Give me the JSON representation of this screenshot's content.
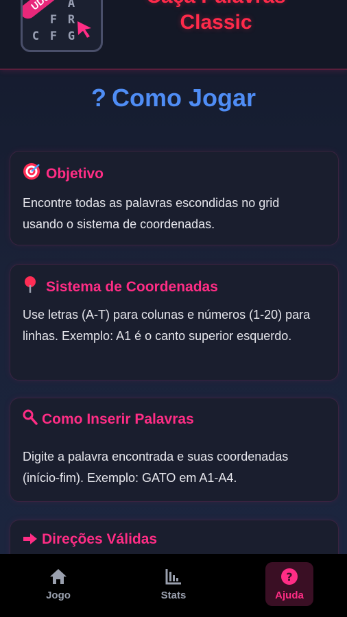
{
  "header": {
    "title_line1": "Caça Palavras",
    "title_line2": "Classic",
    "logo": {
      "pill_text": "UDU",
      "rows": [
        [
          "C",
          "A"
        ],
        [
          "F",
          "R"
        ],
        [
          "C",
          "F",
          "G"
        ]
      ]
    }
  },
  "page": {
    "title_icon": "?",
    "title": "Como Jogar"
  },
  "cards": [
    {
      "icon": "target-icon",
      "title": "Objetivo",
      "text": "Encontre todas as palavras escondidas no grid usando o sistema de coordenadas."
    },
    {
      "icon": "pin-icon",
      "title": "Sistema de Coordenadas",
      "text": "Use letras (A-T) para colunas e números (1-20) para linhas. Exemplo: A1 é o canto superior esquerdo."
    },
    {
      "icon": "magnifier-icon",
      "title": "Como Inserir Palavras",
      "text": "Digite a palavra encontrada e suas coordenadas (início-fim). Exemplo: GATO em A1-A4."
    },
    {
      "icon": "arrow-right-icon",
      "title": "Direções Válidas",
      "text": ""
    }
  ],
  "nav": {
    "items": [
      {
        "label": "Jogo",
        "icon": "home-icon"
      },
      {
        "label": "Stats",
        "icon": "chart-icon"
      },
      {
        "label": "Ajuda",
        "icon": "help-icon",
        "active": true
      }
    ]
  },
  "colors": {
    "accent": "#ff2d85",
    "title_blue": "#4f8df5",
    "header_red": "#ff2a4a"
  }
}
